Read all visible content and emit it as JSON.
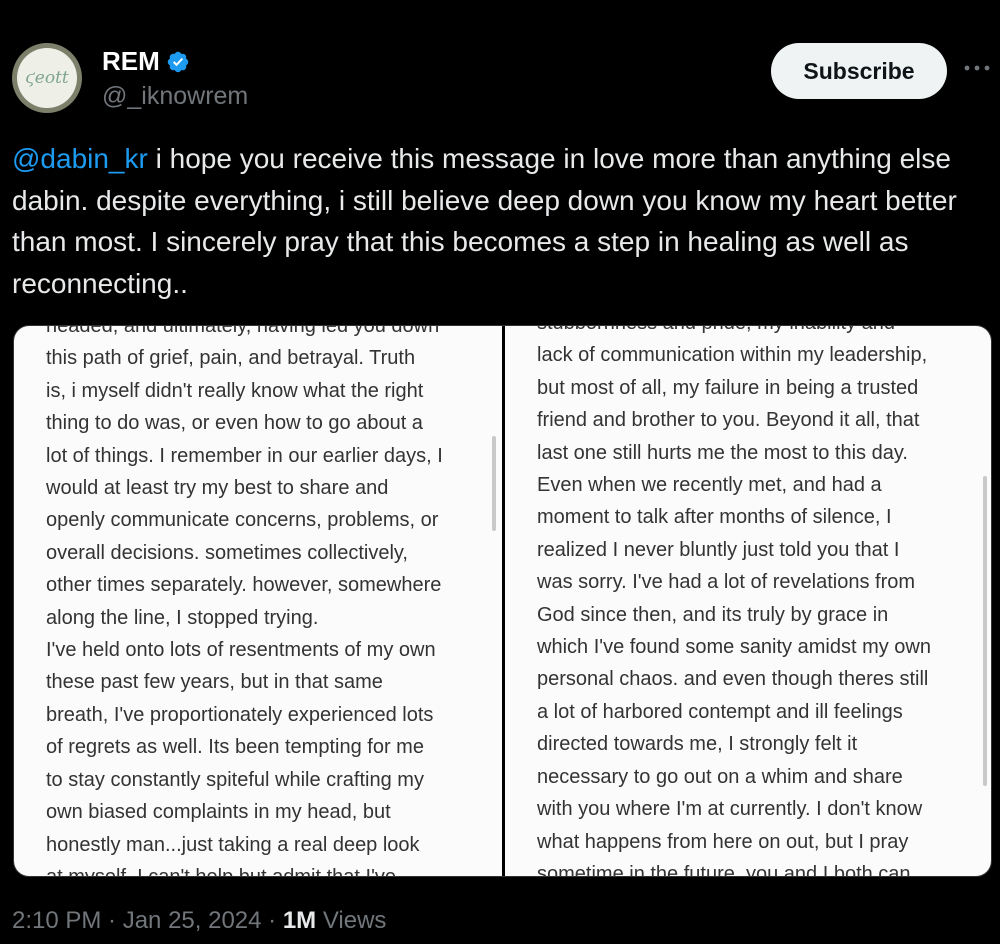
{
  "author": {
    "display_name": "REM",
    "handle": "@_iknowrem",
    "avatar_text": "ϛeott",
    "verified": true
  },
  "actions": {
    "subscribe_label": "Subscribe",
    "more_icon": "more-horizontal-icon"
  },
  "tweet": {
    "mention": "@dabin_kr",
    "body": " i hope you receive this message in love more than anything else dabin. despite everything, i still believe deep down you know my heart better than most. I sincerely pray that this becomes a step in healing as well as reconnecting.."
  },
  "media": {
    "left_page_lines": [
      "headed, and ultimately, having led you down",
      "this path of grief, pain, and betrayal. Truth",
      "is, i myself didn't really know what the right",
      "thing to do was, or even how to go about a",
      "lot of things. I remember in our earlier days, I",
      "would at least try my best to share and",
      "openly communicate concerns, problems, or",
      "overall decisions. sometimes collectively,",
      "other times separately. however, somewhere",
      "along the line, I stopped trying.",
      "I've held onto lots of resentments of my own",
      "these past few years, but in that same",
      "breath, I've proportionately experienced lots",
      "of regrets as well. Its been tempting for me",
      "to stay constantly spiteful while crafting my",
      "own biased complaints in my head, but",
      "honestly man...just taking a real deep look",
      "at myself, I can't help but admit that I've"
    ],
    "right_page_lines": [
      "stubbornness and pride, my inability and",
      "lack of communication within my leadership,",
      "but most of all, my failure in being a trusted",
      "friend and brother to you. Beyond it all, that",
      "last one still hurts me the most to this day.",
      "Even when we recently met, and had a",
      "moment to talk after months of silence, I",
      "realized I never bluntly just told you that I",
      "was sorry. I've had a lot of revelations from",
      "God since then, and its truly by grace in",
      "which I've found some sanity amidst my own",
      "personal chaos. and even though theres still",
      "a lot of harbored contempt and ill feelings",
      "directed towards me, I strongly felt it",
      "necessary to go out on a whim and share",
      "with you where I'm at currently. I don't know",
      "what happens from here on out, but I pray",
      "sometime in the future, you and I both can"
    ]
  },
  "meta": {
    "time": "2:10 PM · Jan 25, 2024 · ",
    "views_count": "1M",
    "views_label": " Views"
  },
  "colors": {
    "background": "#000000",
    "text": "#e7e9ea",
    "muted": "#71767b",
    "link": "#1d9bf0",
    "verified": "#1d9bf0"
  }
}
